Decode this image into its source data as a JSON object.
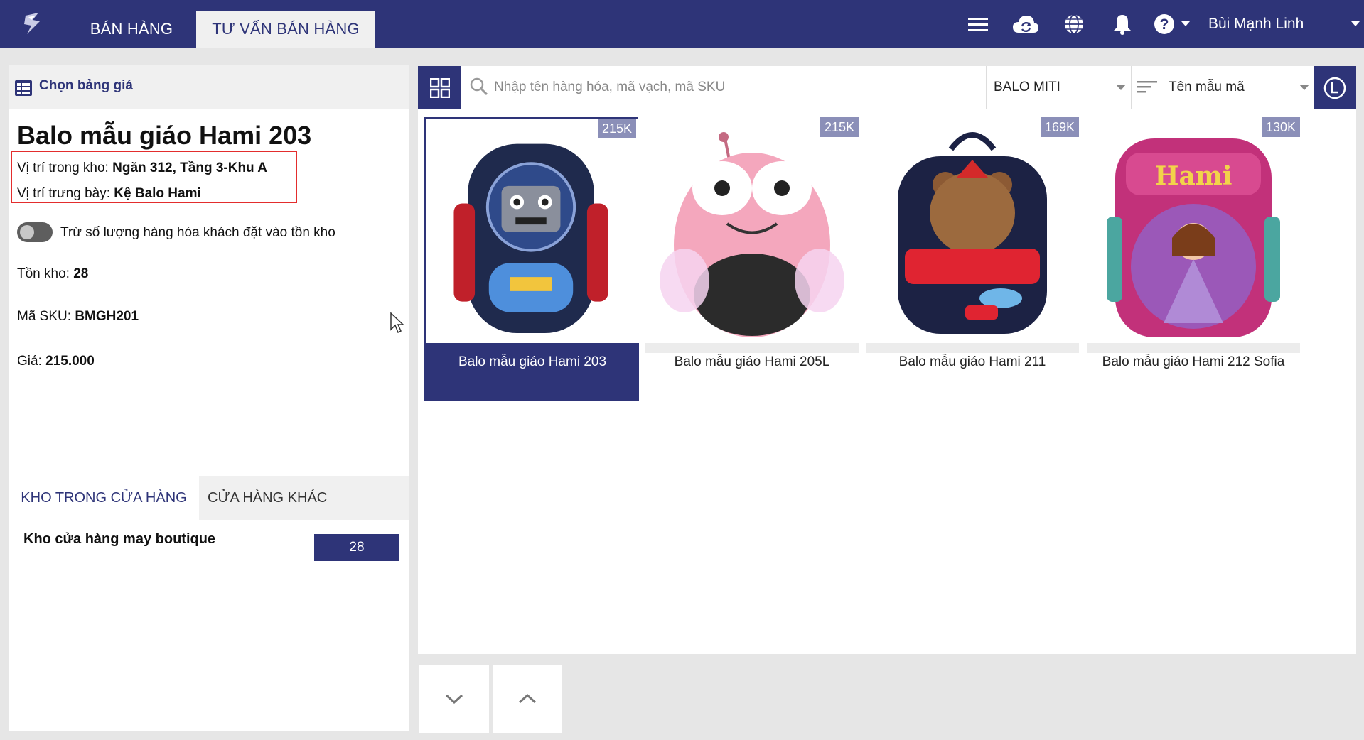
{
  "topbar": {
    "tabs": [
      {
        "label": "BÁN HÀNG",
        "active": false
      },
      {
        "label": "TƯ VẤN BÁN HÀNG",
        "active": true
      }
    ],
    "user_name": "Bùi Mạnh Linh",
    "icons": [
      "menu-icon",
      "cloud-sync-icon",
      "globe-icon",
      "bell-icon",
      "help-icon"
    ]
  },
  "left_panel": {
    "price_list_label": "Chọn bảng giá",
    "product_name": "Balo mẫu giáo Hami 203",
    "warehouse_location_label": "Vị trí trong kho:",
    "warehouse_location_value": "Ngăn 312, Tầng 3-Khu A",
    "display_location_label": "Vị trí trưng bày:",
    "display_location_value": "Kệ Balo Hami",
    "toggle_label": "Trừ số lượng hàng hóa khách đặt vào tồn kho",
    "toggle_on": false,
    "stock_label": "Tồn kho:",
    "stock_value": "28",
    "sku_label": "Mã SKU:",
    "sku_value": "BMGH201",
    "price_label": "Giá:",
    "price_value": "215.000",
    "tabs": [
      {
        "label": "KHO TRONG CỬA HÀNG",
        "active": true
      },
      {
        "label": "CỬA HÀNG KHÁC",
        "active": false
      }
    ],
    "stores": [
      {
        "name": "Kho cửa hàng may boutique",
        "qty": "28"
      }
    ]
  },
  "main": {
    "search_placeholder": "Nhập tên hàng hóa, mã vạch, mã SKU",
    "category_filter": "BALO MITI",
    "sort_by": "Tên mẫu mã",
    "products": [
      {
        "name": "Balo mẫu giáo Hami 203",
        "price": "215K",
        "selected": true,
        "color": "#1f2a4d"
      },
      {
        "name": "Balo mẫu giáo Hami 205L",
        "price": "215K",
        "selected": false,
        "color": "#f4a7bd"
      },
      {
        "name": "Balo mẫu giáo Hami 211",
        "price": "169K",
        "selected": false,
        "color": "#1c2244"
      },
      {
        "name": "Balo mẫu giáo Hami 212 Sofia",
        "price": "130K",
        "selected": false,
        "color": "#c2317a"
      }
    ]
  },
  "colors": {
    "brand": "#2e3478",
    "highlight_border": "#e32d2d",
    "price_badge": "#8b8fb8"
  }
}
